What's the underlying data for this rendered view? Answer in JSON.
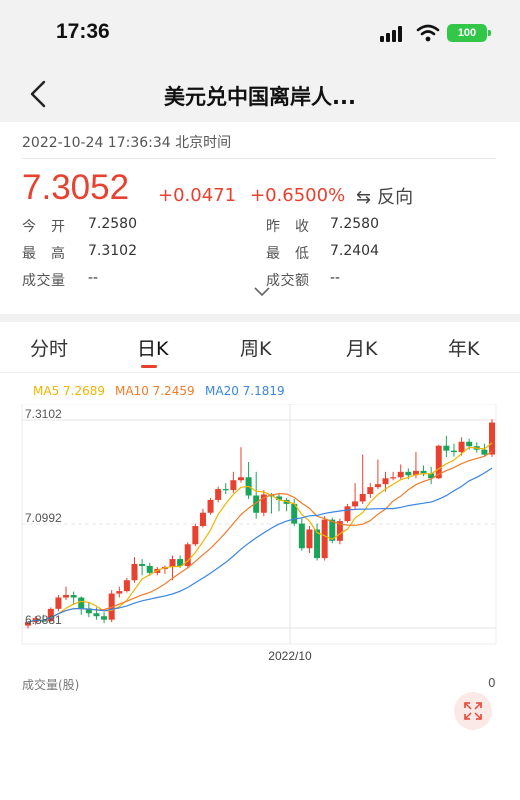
{
  "status_bar": {
    "time": "17:36",
    "battery": "100"
  },
  "nav": {
    "title": "美元兑中国离岸人..."
  },
  "quote": {
    "timestamp": "2022-10-24 17:36:34  北京时间",
    "price": "7.3052",
    "change": "+0.0471",
    "change_pct": "+0.6500%",
    "swap_label": "反向",
    "stats": [
      {
        "label": "今　开",
        "value": "7.2580"
      },
      {
        "label": "昨　收",
        "value": "7.2580"
      },
      {
        "label": "最　高",
        "value": "7.3102"
      },
      {
        "label": "最　低",
        "value": "7.2404"
      },
      {
        "label": "成交量",
        "value": "--"
      },
      {
        "label": "成交额",
        "value": "--"
      }
    ]
  },
  "tabs": [
    "分时",
    "日K",
    "周K",
    "月K",
    "年K"
  ],
  "active_tab": "日K",
  "ma": [
    {
      "label": "MA5 7.2689",
      "color": "#f2b400"
    },
    {
      "label": "MA10 7.2459",
      "color": "#f07b2a"
    },
    {
      "label": "MA20 7.1819",
      "color": "#3a86e0"
    }
  ],
  "colors": {
    "up": "#e8412f",
    "down": "#1aa35a"
  },
  "chart_data": {
    "type": "candlestick",
    "y_ticks": [
      "7.3102",
      "7.0992",
      "6.8881"
    ],
    "ylim": [
      6.8881,
      7.3102
    ],
    "x_label": "2022/10",
    "candles": [
      [
        6.893,
        6.902,
        6.887,
        6.9
      ],
      [
        6.9,
        6.912,
        6.895,
        6.908
      ],
      [
        6.905,
        6.915,
        6.9,
        6.901
      ],
      [
        6.902,
        6.93,
        6.9,
        6.927
      ],
      [
        6.927,
        6.955,
        6.922,
        6.95
      ],
      [
        6.95,
        6.972,
        6.945,
        6.955
      ],
      [
        6.955,
        6.962,
        6.935,
        6.95
      ],
      [
        6.95,
        6.952,
        6.915,
        6.928
      ],
      [
        6.928,
        6.94,
        6.91,
        6.918
      ],
      [
        6.918,
        6.93,
        6.905,
        6.912
      ],
      [
        6.912,
        6.92,
        6.898,
        6.905
      ],
      [
        6.905,
        6.965,
        6.9,
        6.958
      ],
      [
        6.958,
        6.972,
        6.95,
        6.963
      ],
      [
        6.963,
        6.99,
        6.96,
        6.985
      ],
      [
        6.985,
        7.032,
        6.98,
        7.018
      ],
      [
        7.018,
        7.028,
        6.995,
        7.014
      ],
      [
        7.014,
        7.02,
        6.994,
        7.0
      ],
      [
        7.0,
        7.012,
        6.995,
        7.008
      ],
      [
        7.008,
        7.015,
        6.998,
        7.012
      ],
      [
        7.012,
        7.035,
        6.985,
        7.028
      ],
      [
        7.028,
        7.035,
        7.01,
        7.014
      ],
      [
        7.014,
        7.062,
        7.01,
        7.058
      ],
      [
        7.058,
        7.1,
        7.054,
        7.095
      ],
      [
        7.095,
        7.13,
        7.092,
        7.122
      ],
      [
        7.122,
        7.152,
        7.118,
        7.148
      ],
      [
        7.148,
        7.175,
        7.143,
        7.17
      ],
      [
        7.17,
        7.182,
        7.16,
        7.168
      ],
      [
        7.168,
        7.205,
        7.162,
        7.188
      ],
      [
        7.188,
        7.255,
        7.183,
        7.194
      ],
      [
        7.194,
        7.225,
        7.15,
        7.157
      ],
      [
        7.157,
        7.205,
        7.11,
        7.122
      ],
      [
        7.122,
        7.168,
        7.115,
        7.159
      ],
      [
        7.159,
        7.162,
        7.12,
        7.155
      ],
      [
        7.155,
        7.16,
        7.125,
        7.148
      ],
      [
        7.148,
        7.152,
        7.125,
        7.14
      ],
      [
        7.14,
        7.15,
        7.095,
        7.1
      ],
      [
        7.1,
        7.112,
        7.045,
        7.05
      ],
      [
        7.05,
        7.095,
        7.04,
        7.088
      ],
      [
        7.088,
        7.1,
        7.025,
        7.03
      ],
      [
        7.03,
        7.115,
        7.025,
        7.108
      ],
      [
        7.108,
        7.112,
        7.06,
        7.065
      ],
      [
        7.065,
        7.11,
        7.058,
        7.105
      ],
      [
        7.105,
        7.14,
        7.102,
        7.135
      ],
      [
        7.135,
        7.182,
        7.13,
        7.145
      ],
      [
        7.145,
        7.24,
        7.14,
        7.16
      ],
      [
        7.16,
        7.182,
        7.152,
        7.174
      ],
      [
        7.174,
        7.23,
        7.17,
        7.18
      ],
      [
        7.18,
        7.205,
        7.165,
        7.192
      ],
      [
        7.192,
        7.205,
        7.188,
        7.194
      ],
      [
        7.194,
        7.22,
        7.19,
        7.205
      ],
      [
        7.205,
        7.212,
        7.19,
        7.198
      ],
      [
        7.198,
        7.245,
        7.192,
        7.207
      ],
      [
        7.207,
        7.218,
        7.196,
        7.202
      ],
      [
        7.202,
        7.215,
        7.18,
        7.192
      ],
      [
        7.192,
        7.26,
        7.19,
        7.258
      ],
      [
        7.258,
        7.278,
        7.235,
        7.248
      ],
      [
        7.248,
        7.262,
        7.236,
        7.245
      ],
      [
        7.245,
        7.275,
        7.238,
        7.266
      ],
      [
        7.266,
        7.272,
        7.25,
        7.257
      ],
      [
        7.257,
        7.265,
        7.244,
        7.25
      ],
      [
        7.25,
        7.262,
        7.238,
        7.24
      ],
      [
        7.24,
        7.312,
        7.235,
        7.305
      ]
    ]
  }
}
